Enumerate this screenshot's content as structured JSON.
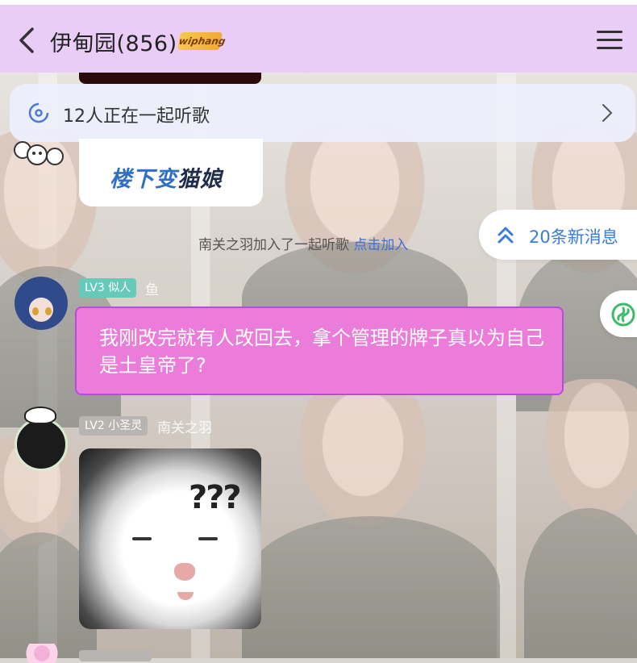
{
  "header": {
    "title": "伊甸园(856)",
    "badge": "wiphang"
  },
  "listen_banner": {
    "text": "12人正在一起听歌"
  },
  "sticker": {
    "text_part1": "楼下变",
    "text_part2": "猫娘"
  },
  "system_message": {
    "text": "南关之羽加入了一起听歌",
    "link": "点击加入"
  },
  "new_messages": {
    "label": "20条新消息"
  },
  "messages": [
    {
      "level": "LV3 似人",
      "sender": "鱼",
      "text": "我刚改完就有人改回去，拿个管理的牌子真以为自己是土皇帝了?"
    },
    {
      "level": "LV2 小圣灵",
      "sender": "南关之羽",
      "image_caption": "???"
    }
  ],
  "colors": {
    "header_bg": "#e9cdf6",
    "bubble_bg": "#eb7cda",
    "bubble_border": "#b94cdd",
    "link": "#3d6fd8",
    "lv3_badge": "#67c9b9",
    "lv2_badge": "#b7b4b1"
  },
  "icons": [
    "back-arrow-icon",
    "menu-icon",
    "music-disc-icon",
    "chevron-right-icon",
    "double-chevron-up-icon",
    "app-logo-icon"
  ]
}
